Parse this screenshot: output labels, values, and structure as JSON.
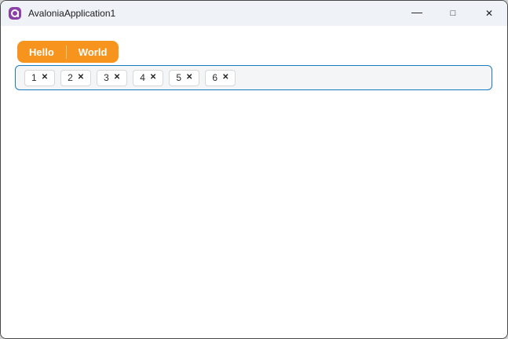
{
  "window": {
    "title": "AvaloniaApplication1"
  },
  "icons": {
    "app_logo": "avalonia-logo",
    "minimize": "—",
    "maximize": "□",
    "close": "✕",
    "chip_remove": "✕"
  },
  "tabs": [
    {
      "label": "Hello"
    },
    {
      "label": "World"
    }
  ],
  "chips": [
    {
      "value": "1"
    },
    {
      "value": "2"
    },
    {
      "value": "3"
    },
    {
      "value": "4"
    },
    {
      "value": "5"
    },
    {
      "value": "6"
    }
  ],
  "colors": {
    "accent_orange": "#F7941E",
    "focus_border": "#1E7AC0",
    "titlebar_bg": "#EFF3F8",
    "window_border": "#474747",
    "chip_border": "#D8D8D8",
    "chipbox_bg": "#F4F5F7"
  }
}
